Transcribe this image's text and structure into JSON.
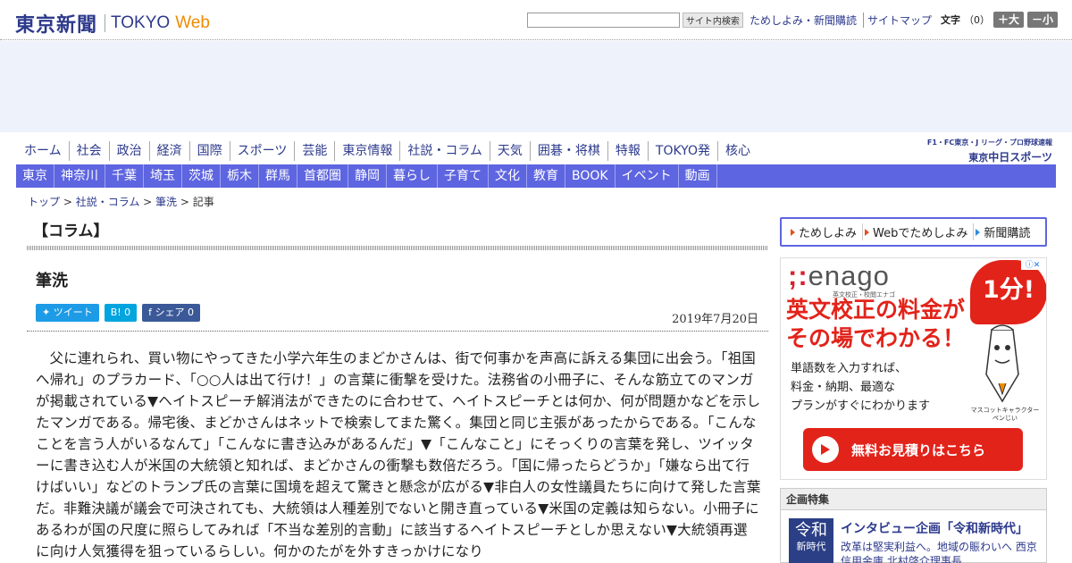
{
  "header": {
    "logo_jp": "東京新聞",
    "logo_tokyo": "TOKYO",
    "logo_web": "Web",
    "search_placeholder": "",
    "search_button": "サイト内検索",
    "links": [
      "ためしよみ・新聞購読",
      "サイトマップ"
    ],
    "font_label": "文字",
    "font_count": "（0）",
    "font_bigger": "＋大",
    "font_smaller": "－小"
  },
  "nav_main": [
    "ホーム",
    "社会",
    "政治",
    "経済",
    "国際",
    "スポーツ",
    "芸能",
    "東京情報",
    "社説・コラム",
    "天気",
    "囲碁・将棋",
    "特報",
    "TOKYO発",
    "核心"
  ],
  "chunichi": {
    "line1": "F1・FC東京・J リーグ・プロ野球速報",
    "prefix": "東京",
    "name": "中日スポーツ"
  },
  "nav_sub": [
    "東京",
    "神奈川",
    "千葉",
    "埼玉",
    "茨城",
    "栃木",
    "群馬",
    "首都圏",
    "静岡",
    "暮らし",
    "子育て",
    "文化",
    "教育",
    "BOOK",
    "イベント",
    "動画"
  ],
  "breadcrumb": {
    "top": "トップ",
    "sep": " > ",
    "section": "社説・コラム",
    "column": "筆洗",
    "current": "記事"
  },
  "article": {
    "section_title": "【コラム】",
    "title": "筆洗",
    "share": {
      "tweet": "ツイート",
      "hatena": "B! 0",
      "facebook": "シェア 0"
    },
    "date": "2019年7月20日",
    "body": "父に連れられ、買い物にやってきた小学六年生のまどかさんは、街で何事かを声高に訴える集団に出会う。「祖国へ帰れ」のプラカード、「○○人は出て行け！」の言葉に衝撃を受けた。法務省の小冊子に、そんな筋立てのマンガが掲載されている▼ヘイトスピーチ解消法ができたのに合わせて、ヘイトスピーチとは何か、何が問題かなどを示したマンガである。帰宅後、まどかさんはネットで検索してまた驚く。集団と同じ主張があったからである。「こんなことを言う人がいるなんて」「こんなに書き込みがあるんだ」▼「こんなこと」にそっくりの言葉を発し、ツイッターに書き込む人が米国の大統領と知れば、まどかさんの衝撃も数倍だろう。「国に帰ったらどうか」「嫌なら出て行けばいい」などのトランプ氏の言葉に国境を超えて驚きと懸念が広がる▼非白人の女性議員たちに向けて発した言葉だ。非難決議が議会で可決されても、大統領は人種差別でないと開き直っている▼米国の定義は知らない。小冊子にあるわが国の尺度に照らしてみれば「不当な差別的言動」に該当するヘイトスピーチとしか思えない▼大統領再選に向け人気獲得を狙っているらしい。何かのたがを外すきっかけになり"
  },
  "sidebar": {
    "subscribe_links": [
      "ためしよみ",
      "Webでためしよみ",
      "新聞購読"
    ],
    "ad": {
      "logo": "enago",
      "logo_sub": "英文校正・校閲エナゴ",
      "bubble": "1分!",
      "headline1": "英文校正の料金が",
      "headline2": "その場でわかる！",
      "text": [
        "単語数を入力すれば、",
        "料金・納期、最適な",
        "プランがすぐにわかります"
      ],
      "mascot_caption": [
        "マスコットキャラクター",
        "ペンじい"
      ],
      "cta": "無料お見積りはこちら"
    },
    "kikaku": {
      "heading": "企画特集",
      "thumb_line1": "令和",
      "thumb_line2": "新時代",
      "title": "インタビュー企画「令和新時代」",
      "text": "改革は堅実利益へ。地域の賑わいへ 西京信用金庫 北村啓介理事長"
    }
  },
  "colors": {
    "brand_navy": "#2d3a8c",
    "web_orange": "#f08a00",
    "subnav_blue": "#5e65e0",
    "ad_red": "#e2231a"
  }
}
